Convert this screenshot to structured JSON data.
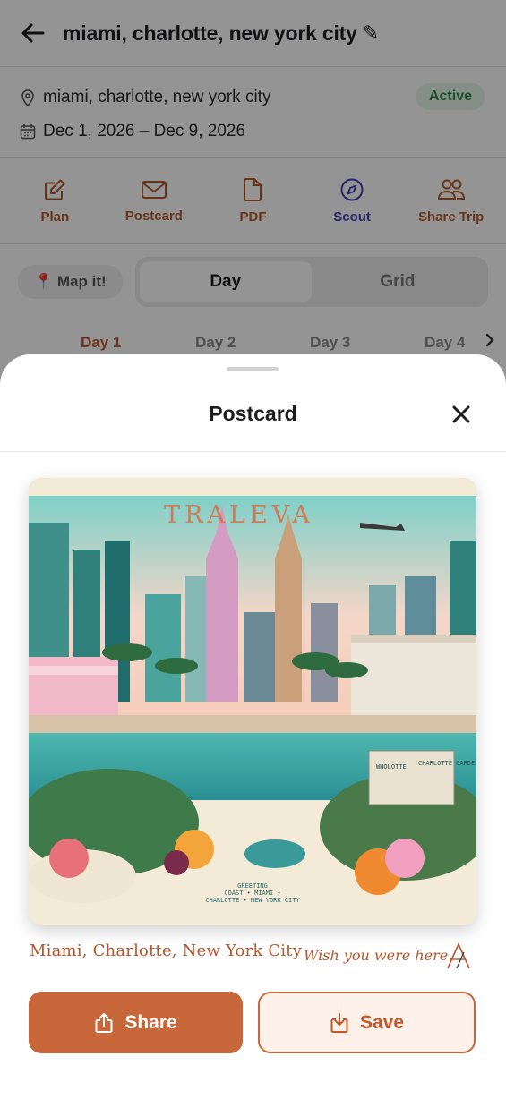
{
  "header": {
    "title": "miami, charlotte, new york city",
    "edit_icon": "pencil-icon"
  },
  "trip": {
    "location": "miami, charlotte, new york city",
    "dates": "Dec 1, 2026 – Dec 9, 2026",
    "status": "Active"
  },
  "actions": [
    {
      "label": "Plan",
      "icon": "edit-square-icon"
    },
    {
      "label": "Postcard",
      "icon": "mail-icon"
    },
    {
      "label": "PDF",
      "icon": "document-icon"
    },
    {
      "label": "Scout",
      "icon": "compass-icon"
    },
    {
      "label": "Share Trip",
      "icon": "people-icon"
    }
  ],
  "controls": {
    "map_button": "📍 Map it!",
    "view_modes": [
      "Day",
      "Grid"
    ],
    "selected_view": "Day"
  },
  "days": [
    "Day 1",
    "Day 2",
    "Day 3",
    "Day 4"
  ],
  "sheet": {
    "title": "Postcard",
    "postcard": {
      "brand_text": "TRALEVA",
      "greeting_lines": [
        "GREETING",
        "COAST • MIAMI •",
        "CHARLOTTE • NEW YORK CITY"
      ],
      "stamp_text_1": "WHOLOTTE",
      "stamp_text_2": "CHARLOTTE GARDENS"
    },
    "caption_left": "Miami, Charlotte, New York City",
    "caption_right": "Wish you were here.",
    "share_label": "Share",
    "save_label": "Save"
  },
  "colors": {
    "accent": "#c8683a",
    "scout": "#4a3fb8",
    "active_badge": "#2f8a45"
  }
}
